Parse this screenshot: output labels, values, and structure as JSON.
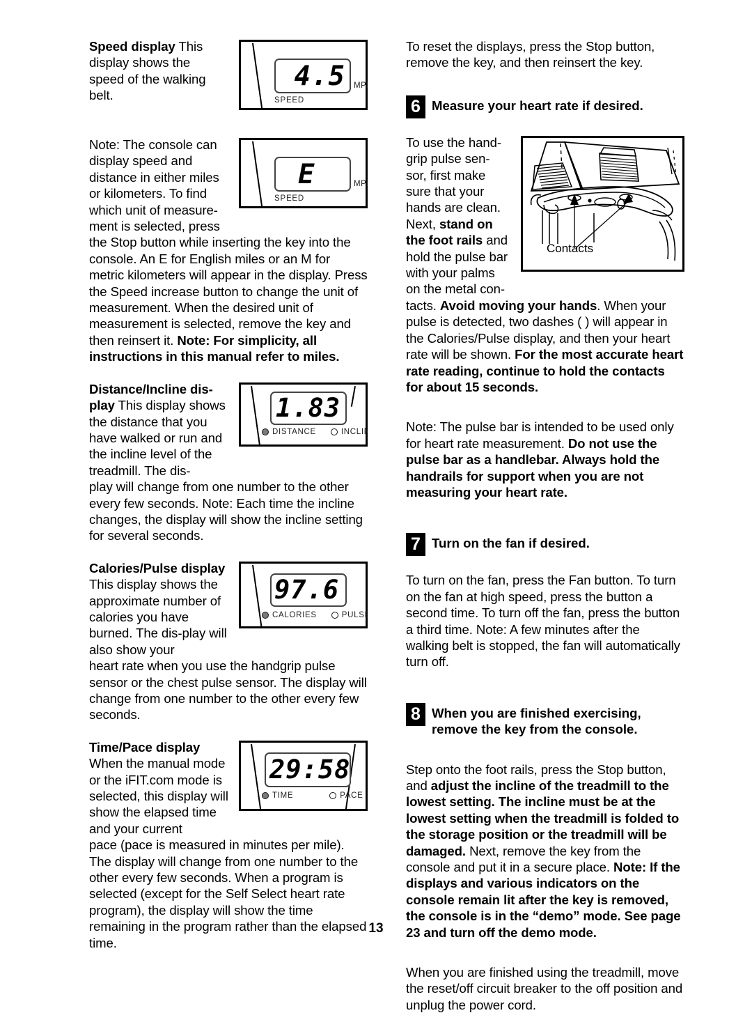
{
  "page": {
    "number": "13"
  },
  "left_column": {
    "speed_display": {
      "heading": "Speed display",
      "body": " This display shows the speed of the walking belt.",
      "figure": {
        "value": "4.5",
        "unit": "MPH",
        "label": "SPEED"
      }
    },
    "units_note": {
      "wrap_text": "Note: The console can display speed and distance in either miles or kilometers. To find which unit of measure-ment is selected, press ",
      "full_text": "the Stop button while inserting the key into the console. An  E  for English miles or an  M  for metric kilometers will appear in the display. Press the Speed increase button to change the unit of measurement. When the desired unit of measurement is selected, remove the key and then reinsert it. ",
      "bold_tail": "Note: For simplicity, all instructions in this manual refer to miles.",
      "figure": {
        "value": "E",
        "unit": "MPH",
        "label": "SPEED"
      }
    },
    "distance_incline_display": {
      "heading": "Distance/Incline dis-play",
      "wrap_text": " This display shows the distance that you have walked or run and the incline level of the treadmill. The dis-",
      "full_text": "play will change from one number to the other every few seconds. Note: Each time the incline changes, the display will show the incline setting for several seconds.",
      "figure": {
        "value": "1.83",
        "indicator_1": "DISTANCE",
        "indicator_2": "INCLINE"
      }
    },
    "calories_pulse_display": {
      "heading": "Calories/Pulse display",
      "wrap_text": " This display shows the approximate number of calories you have burned. The dis-play will also show your ",
      "full_text": "heart rate when you use the handgrip pulse sensor or the chest pulse sensor. The display will change from one number to the other every few seconds.",
      "figure": {
        "value": "97.6",
        "indicator_1": "CALORIES",
        "indicator_2": "PULSE"
      }
    },
    "time_pace_display": {
      "heading": "Time/Pace display",
      "wrap_text": "When the manual mode or the iFIT.com mode is selected, this display will show the elapsed time and your current ",
      "full_text": "pace (pace is measured in minutes per mile). The display will change from one number to the other every few seconds. When a program is selected (except for the Self Select heart rate program), the display will show the time remaining in the program rather than the elapsed time.",
      "figure": {
        "value": "29:58",
        "indicator_1": "TIME",
        "indicator_2": "PACE"
      }
    }
  },
  "right_column": {
    "reset_note": "To reset the displays, press the Stop button, remove the key, and then reinsert the key.",
    "step_6": {
      "number": "6",
      "title": "Measure your heart rate if desired.",
      "wrap_text_1": "To use the hand-grip pulse sen-sor, first make sure that your hands are clean. Next, ",
      "wrap_bold_1": "stand on the foot rails",
      "wrap_text_2": " and hold the pulse bar with your palms on the metal con-",
      "body_text_1": "tacts. ",
      "body_bold_1": "Avoid moving your hands",
      "body_text_2": ". When your pulse is detected, two dashes (   ) will appear in the Calories/Pulse display, and then your heart rate will be shown. ",
      "body_bold_2": "For the most accurate heart rate reading, continue to hold the contacts for about 15 seconds.",
      "note_text_1": "Note: The pulse bar is intended to be used only for heart rate measurement. ",
      "note_bold_1": "Do not use the pulse bar as a handlebar. Always hold the handrails for support when you are not measuring your heart rate.",
      "figure_label": "Contacts"
    },
    "step_7": {
      "number": "7",
      "title": "Turn on the fan if desired.",
      "body": "To turn on the fan, press the Fan button. To turn on the fan at high speed, press the button a second time. To turn off the fan, press the button a third time. Note: A few minutes after the walking belt is stopped, the fan will automatically turn off."
    },
    "step_8": {
      "number": "8",
      "title": "When you are finished exercising, remove the key from the console.",
      "body_text_1": "Step onto the foot rails, press the Stop button, and ",
      "body_bold_1": "adjust the incline of the treadmill to the lowest setting. The incline must be at the lowest setting when the treadmill is folded to the storage position or the treadmill will be damaged.",
      "body_text_2": " Next, remove the key from the console and put it in a secure place. ",
      "body_bold_2": "Note: If the displays and various indicators on the console remain lit after the key is removed, the console is in the “demo” mode. See page 23 and turn off the demo mode.",
      "closing": "When you are finished using the treadmill, move the reset/off circuit breaker to the off position and unplug the power cord."
    }
  }
}
